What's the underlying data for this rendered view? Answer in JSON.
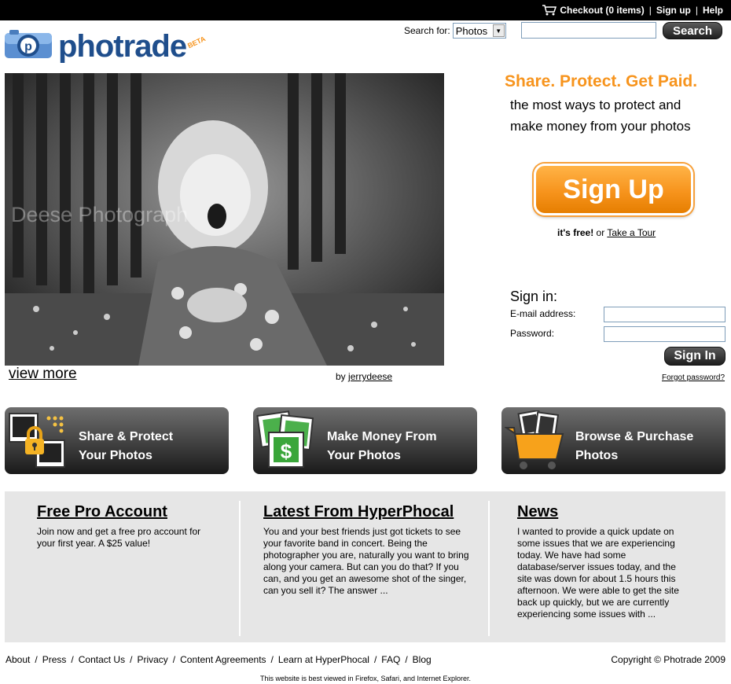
{
  "topbar": {
    "checkout": "Checkout (0 items)",
    "signup": "Sign up",
    "help": "Help",
    "separator": "|"
  },
  "header": {
    "logo_text": "photrade",
    "logo_badge": "BETA",
    "search_label": "Search for:",
    "search_type": "Photos",
    "search_placeholder": "",
    "search_button": "Search"
  },
  "featured": {
    "watermark": "Deese Photograph",
    "view_more": "view more",
    "by": "by",
    "author": "jerrydeese"
  },
  "promo": {
    "tagline": "Share. Protect. Get Paid.",
    "subtitle": "the most ways to protect and make money from your photos",
    "signup_button": "Sign Up",
    "free_text": "it's free!",
    "or_text": "or",
    "tour_link": "Take a Tour"
  },
  "signin": {
    "title": "Sign in:",
    "email_label": "E-mail address:",
    "password_label": "Password:",
    "button": "Sign In",
    "forgot": "Forgot password?"
  },
  "features": [
    {
      "line1": "Share & Protect",
      "line2": "Your Photos",
      "icon": "lock-photos-icon"
    },
    {
      "line1": "Make Money From",
      "line2": "Your Photos",
      "icon": "money-photos-icon"
    },
    {
      "line1": "Browse & Purchase",
      "line2": "Photos",
      "icon": "shopping-cart-icon"
    }
  ],
  "info": {
    "col1": {
      "title": "Free Pro Account",
      "body": "Join now and get a free pro account for your first year. A $25 value!"
    },
    "col2": {
      "title": "Latest From HyperPhocal",
      "body": "You and your best friends just got tickets to see your favorite band in concert. Being the photographer you are, naturally you want to bring along your camera. But can you do that? If you can, and you get an awesome shot of the singer, can you sell it? The answer ..."
    },
    "col3": {
      "title": "News",
      "body": "I wanted to provide a quick update on some issues that we are experiencing today.  We have had some database/server issues today, and the site was down for about 1.5 hours this afternoon. We were able to get the site back up quickly, but we are currently experiencing some issues with ..."
    }
  },
  "footer": {
    "links": [
      "About",
      "Press",
      "Contact Us",
      "Privacy",
      "Content Agreements",
      "Learn at HyperPhocal",
      "FAQ",
      "Blog"
    ],
    "separator": "/",
    "copyright": "Copyright © Photrade 2009",
    "best_viewed": "This website is best viewed in Firefox, Safari, and Internet Explorer."
  },
  "colors": {
    "accent_orange": "#f7941d",
    "logo_blue": "#1f4e8c",
    "dark_button": "#2a2a2a",
    "panel_gray": "#e6e6e6"
  }
}
